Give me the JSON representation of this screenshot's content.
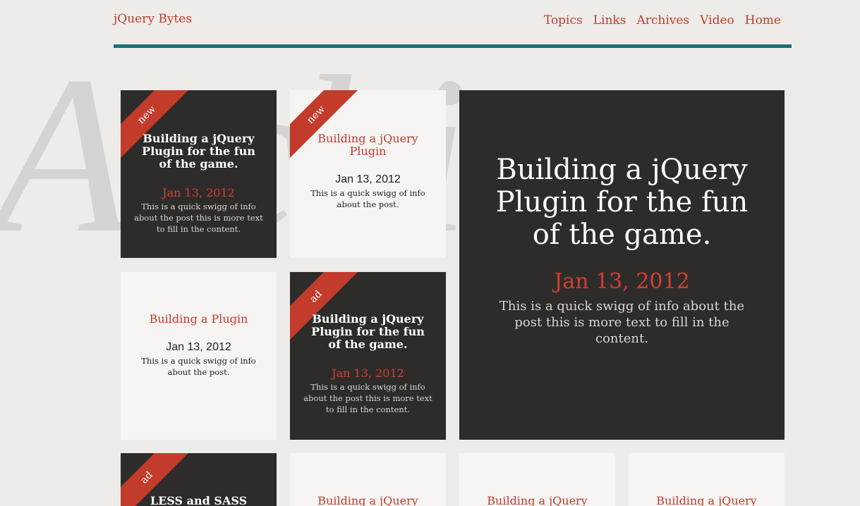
{
  "site": {
    "brand": "jQuery Bytes",
    "watermark": "Archives"
  },
  "nav": [
    "Topics",
    "Links",
    "Archives",
    "Video",
    "Home"
  ],
  "tiles": [
    {
      "theme": "dark",
      "ribbon": "new",
      "title": "Building a jQuery Plugin for the fun of the game.",
      "date": "Jan 13, 2012",
      "text": "This is a quick swigg of info about the post this is more text to fill in the content."
    },
    {
      "theme": "light",
      "ribbon": "new",
      "title": "Building a jQuery Plugin",
      "date": "Jan 13, 2012",
      "text": "This is a quick swigg of info about the post."
    },
    {
      "theme": "dark",
      "ribbon": "",
      "title": "Building a jQuery Plugin for the fun of the game.",
      "date": "Jan 13, 2012",
      "text": "This is a quick swigg of info about the post this is more text to fill in the content."
    },
    {
      "theme": "light",
      "ribbon": "",
      "title": "Building a Plugin",
      "date": "Jan 13, 2012",
      "text": "This is a quick swigg of info about the post."
    },
    {
      "theme": "dark",
      "ribbon": "ad",
      "title": "Building a jQuery Plugin for the fun of the game.",
      "date": "Jan 13, 2012",
      "text": "This is a quick swigg of info about the post this is more text to fill in the content."
    },
    {
      "theme": "dark",
      "ribbon": "ad",
      "title": "LESS and SASS made",
      "date": "",
      "text": ""
    },
    {
      "theme": "light",
      "ribbon": "",
      "title": "Building a jQuery",
      "date": "",
      "text": ""
    },
    {
      "theme": "light",
      "ribbon": "",
      "title": "Building a jQuery",
      "date": "",
      "text": ""
    },
    {
      "theme": "light",
      "ribbon": "",
      "title": "Building a jQuery",
      "date": "",
      "text": ""
    }
  ]
}
